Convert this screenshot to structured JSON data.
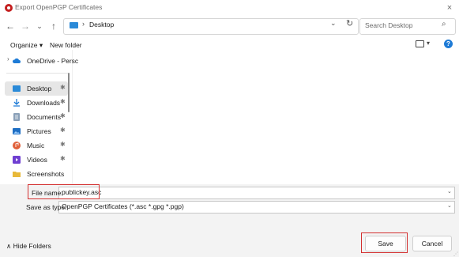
{
  "window": {
    "title": "Export OpenPGP Certificates",
    "close": "×"
  },
  "nav": {
    "back": "←",
    "forward": "→",
    "recent": "⌄",
    "up": "↑"
  },
  "address": {
    "separator": "›",
    "path": "Desktop",
    "chevron": "⌄",
    "refresh": "↻"
  },
  "search": {
    "placeholder": "Search Desktop",
    "icon": "⌕"
  },
  "toolbar": {
    "organize": "Organize ▾",
    "new_folder": "New folder",
    "view_chevron": "▾",
    "help": "?"
  },
  "sidebar": {
    "onedrive_chevron": "›",
    "pin": "📌",
    "items": [
      {
        "label": "OneDrive - Persc",
        "icon": "cloud",
        "color": "#1e7bd6"
      },
      {
        "label": "Desktop",
        "icon": "desktop",
        "color": "#2a8ad8"
      },
      {
        "label": "Downloads",
        "icon": "download",
        "color": "#1e7bd6"
      },
      {
        "label": "Documents",
        "icon": "documents",
        "color": "#8aa0b8"
      },
      {
        "label": "Pictures",
        "icon": "pictures",
        "color": "#1f6fc4"
      },
      {
        "label": "Music",
        "icon": "music",
        "color": "#e0603a"
      },
      {
        "label": "Videos",
        "icon": "videos",
        "color": "#6f3fd1"
      },
      {
        "label": "Screenshots",
        "icon": "folder",
        "color": "#e8b93a"
      }
    ]
  },
  "form": {
    "file_name_label": "File name:",
    "file_name_value": "publickey.asc",
    "save_as_type_label": "Save as type:",
    "save_as_type_value": "OpenPGP Certificates (*.asc *.gpg *.pgp)",
    "dropdown_chevron": "⌄"
  },
  "footer": {
    "hide_folders": "∧  Hide Folders",
    "save": "Save",
    "cancel": "Cancel",
    "grip": "⋰"
  },
  "colors": {
    "highlight": "#d32f2f",
    "accent": "#1e7bd6"
  }
}
